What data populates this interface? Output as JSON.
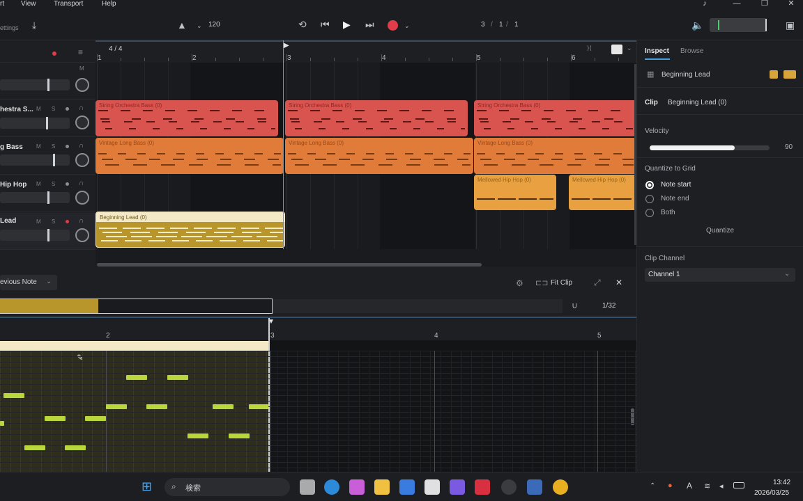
{
  "menu": [
    "rt",
    "View",
    "Transport",
    "Help"
  ],
  "toolbar": {
    "tempo": "120",
    "position": [
      "3",
      "/",
      "1",
      "/",
      "1"
    ],
    "left_label": "ettings"
  },
  "timeline": {
    "time_signature": "4 / 4",
    "bars": [
      "1",
      "2",
      "3",
      "4",
      "5",
      "6"
    ]
  },
  "tracks": [
    {
      "name": "",
      "color": "#000000"
    },
    {
      "name": "hestra S...",
      "color": "#d9534f"
    },
    {
      "name": "g Bass",
      "color": "#e07b39"
    },
    {
      "name": "Hip Hop",
      "color": "#e89a3c"
    },
    {
      "name": "Lead",
      "color": "#b9962b"
    }
  ],
  "track_ms": [
    "M",
    "S"
  ],
  "clips": {
    "strings_1": "String Orchestra Bass (0)",
    "strings_2": "String Orchestra Bass (0)",
    "strings_3": "String Orchestra Bass (0)",
    "bass_1": "Vintage Long Bass (0)",
    "bass_2": "Vintage Long Bass (0)",
    "bass_3": "Vintage Long Bass (0)",
    "hiphop_1": "Mellowed Hip Hop (0)",
    "hiphop_2": "Mellowed Hip Hop (0)",
    "lead_1": "Beginning Lead (0)"
  },
  "inspector": {
    "tabs": [
      "Inspect",
      "Browse"
    ],
    "track_name": "Beginning Lead",
    "clip_label": "Clip",
    "clip_name": "Beginning Lead (0)",
    "velocity_label": "Velocity",
    "velocity_value": "90",
    "velocity_fraction": 0.71,
    "quantize_label": "Quantize to Grid",
    "options": [
      "Note start",
      "Note end",
      "Both"
    ],
    "selected_option": "Note start",
    "quantize_button": "Quantize",
    "channel_label": "Clip Channel",
    "channel_value": "Channel 1"
  },
  "editor": {
    "mode": "evious Note",
    "fit_clip": "Fit Clip",
    "grid": "1/32",
    "bars": [
      "2",
      "3",
      "4",
      "5"
    ]
  },
  "taskbar": {
    "search": "検索",
    "time": "13:42",
    "date": "2026/03/25"
  },
  "colors": {
    "strings": "#d9534f",
    "bass": "#e07b39",
    "hiphop": "#e8a040",
    "lead": "#b9962b",
    "note": "#b9d63c",
    "record": "#e03c4a"
  }
}
